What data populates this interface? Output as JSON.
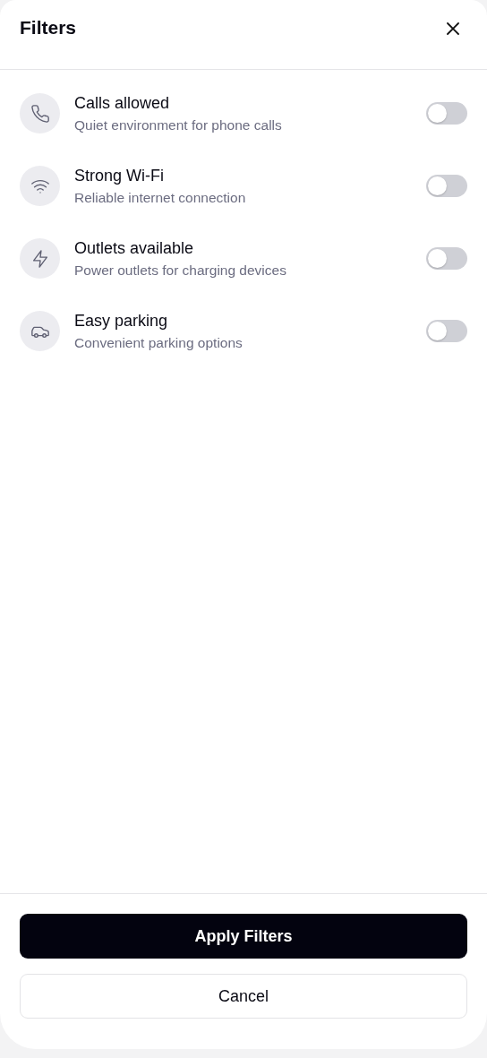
{
  "header": {
    "title": "Filters"
  },
  "filters": [
    {
      "kind": "phone",
      "label": "Calls allowed",
      "description": "Quiet environment for phone calls",
      "on": false
    },
    {
      "kind": "wifi",
      "label": "Strong Wi-Fi",
      "description": "Reliable internet connection",
      "on": false
    },
    {
      "kind": "bolt",
      "label": "Outlets available",
      "description": "Power outlets for charging devices",
      "on": false
    },
    {
      "kind": "car",
      "label": "Easy parking",
      "description": "Convenient parking options",
      "on": false
    }
  ],
  "footer": {
    "primary": "Apply Filters",
    "secondary": "Cancel"
  }
}
